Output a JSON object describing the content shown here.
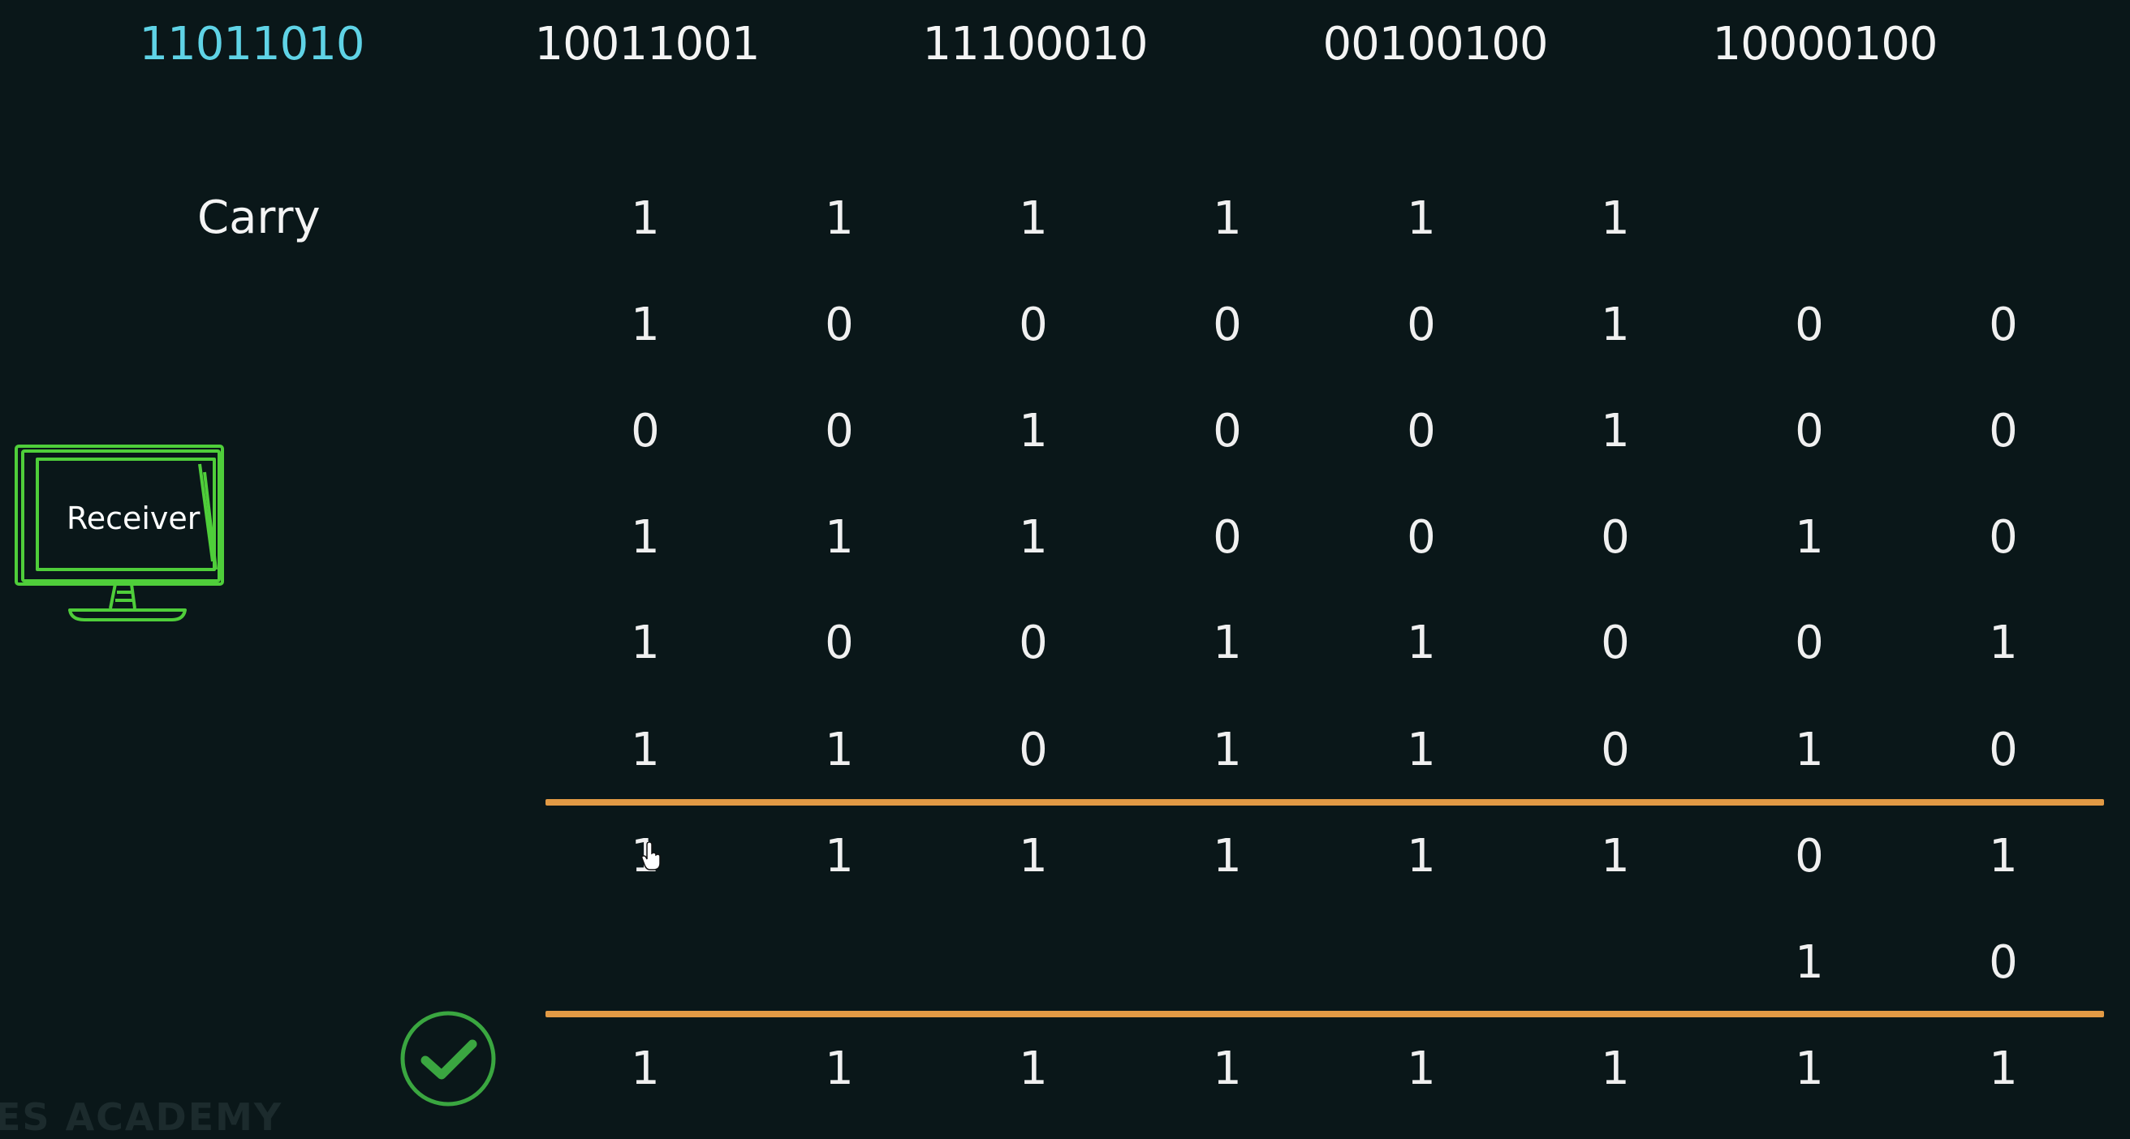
{
  "header": {
    "words": [
      "11011010",
      "10011001",
      "11100010",
      "00100100",
      "10000100"
    ]
  },
  "carry_label": "Carry",
  "receiver_label": "Receiver",
  "watermark": "ES ACADEMY",
  "rows": {
    "carry": [
      "1",
      "1",
      "1",
      "1",
      "1",
      "1",
      "",
      ""
    ],
    "row1": [
      "1",
      "0",
      "0",
      "0",
      "0",
      "1",
      "0",
      "0"
    ],
    "row2": [
      "0",
      "0",
      "1",
      "0",
      "0",
      "1",
      "0",
      "0"
    ],
    "row3": [
      "1",
      "1",
      "1",
      "0",
      "0",
      "0",
      "1",
      "0"
    ],
    "row4": [
      "1",
      "0",
      "0",
      "1",
      "1",
      "0",
      "0",
      "1"
    ],
    "row5": [
      "1",
      "1",
      "0",
      "1",
      "1",
      "0",
      "1",
      "0"
    ],
    "sum": [
      "1",
      "1",
      "1",
      "1",
      "1",
      "1",
      "0",
      "1"
    ],
    "wrap": [
      "",
      "",
      "",
      "",
      "",
      "",
      "1",
      "0"
    ],
    "result": [
      "1",
      "1",
      "1",
      "1",
      "1",
      "1",
      "1",
      "1"
    ]
  },
  "colors": {
    "background": "#0a1719",
    "highlight_word": "#5fd3e6",
    "divider": "#e29a45",
    "monitor": "#4fce3a",
    "check": "#3aa640"
  },
  "icons": {
    "receiver": "monitor-icon",
    "status": "check-circle-icon",
    "pointer": "hand-cursor-icon"
  }
}
